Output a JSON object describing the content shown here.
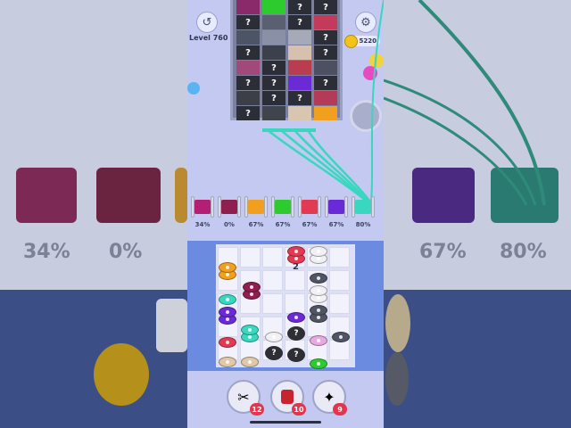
{
  "game": {
    "level_label": "Level 760",
    "coins": "5220",
    "hidden_mark": "?",
    "bobbin_count": "2"
  },
  "spools": [
    {
      "color": "#b21f73",
      "pct": "34%"
    },
    {
      "color": "#8e1f4e",
      "pct": "0%"
    },
    {
      "color": "#f0a01e",
      "pct": "67%"
    },
    {
      "color": "#2ecb2e",
      "pct": "67%"
    },
    {
      "color": "#e23a52",
      "pct": "67%"
    },
    {
      "color": "#6a2bd6",
      "pct": "67%"
    },
    {
      "color": "#39d6c0",
      "pct": "80%"
    }
  ],
  "background_percentages": [
    "34%",
    "0%",
    "67%",
    "80%"
  ],
  "tools": [
    {
      "icon": "scissors-icon",
      "count": "12"
    },
    {
      "icon": "thread-spool-icon",
      "count": "10"
    },
    {
      "icon": "magic-wand-icon",
      "count": "9"
    }
  ],
  "colors": {
    "accent_teal": "#39d6c0",
    "badge_red": "#e2364e",
    "board_blue": "#6a8be0"
  }
}
